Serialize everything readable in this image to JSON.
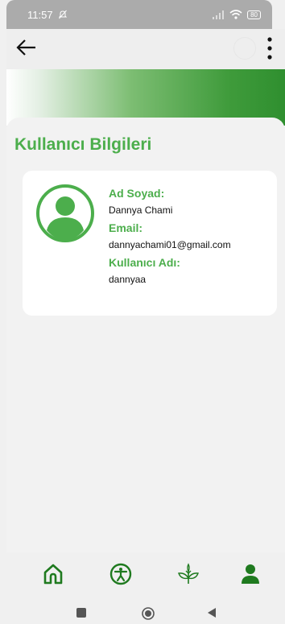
{
  "status_bar": {
    "time": "11:57",
    "battery": "80"
  },
  "section_title": "Kullanıcı Bilgileri",
  "user_info": {
    "name_label": "Ad Soyad:",
    "name_value": "Dannya Chami",
    "email_label": "Email:",
    "email_value": "dannyachami01@gmail.com",
    "username_label": "Kullanıcı Adı:",
    "username_value": "dannyaa"
  },
  "bottom_nav": [
    "home-icon",
    "accessibility-icon",
    "plant-icon",
    "person-icon"
  ],
  "colors": {
    "accent": "#4cae4c",
    "banner_dark": "#2f8f2f",
    "status_bar": "#ababab"
  }
}
